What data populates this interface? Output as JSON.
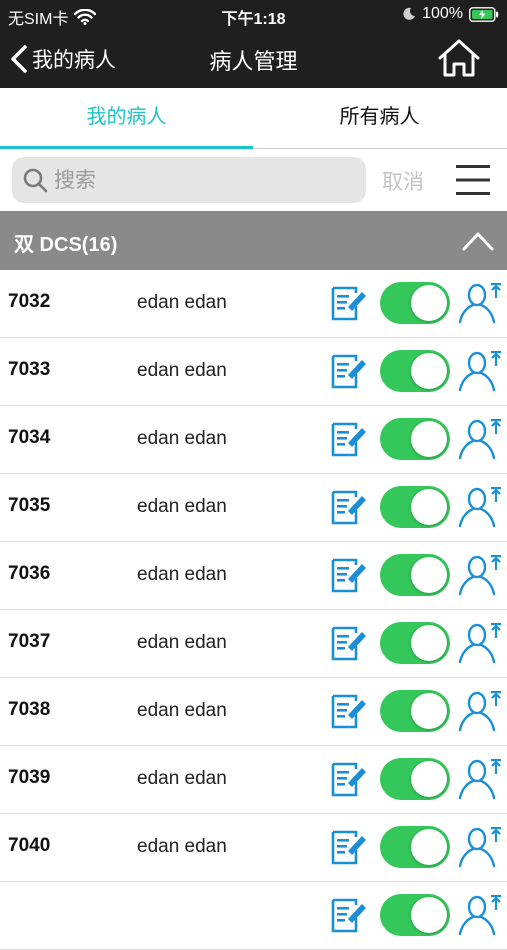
{
  "colors": {
    "accent": "#1cc4c9",
    "toggle_on": "#34c759",
    "icon_blue": "#1a8fd6",
    "header_dark": "#1f1f1f",
    "group_gray": "#8a8a8a"
  },
  "status_bar": {
    "carrier": "无SIM卡",
    "time": "下午1:18",
    "battery": "100%"
  },
  "nav": {
    "back_label": "我的病人",
    "title": "病人管理"
  },
  "tabs": [
    {
      "label": "我的病人",
      "active": true
    },
    {
      "label": "所有病人",
      "active": false
    }
  ],
  "search": {
    "placeholder": "搜索",
    "value": "",
    "cancel_label": "取消"
  },
  "group": {
    "title": "双 DCS(16)"
  },
  "patients": [
    {
      "id": "7032",
      "name": "edan edan",
      "enabled": true
    },
    {
      "id": "7033",
      "name": "edan edan",
      "enabled": true
    },
    {
      "id": "7034",
      "name": "edan edan",
      "enabled": true
    },
    {
      "id": "7035",
      "name": "edan edan",
      "enabled": true
    },
    {
      "id": "7036",
      "name": "edan edan",
      "enabled": true
    },
    {
      "id": "7037",
      "name": "edan edan",
      "enabled": true
    },
    {
      "id": "7038",
      "name": "edan edan",
      "enabled": true
    },
    {
      "id": "7039",
      "name": "edan edan",
      "enabled": true
    },
    {
      "id": "7040",
      "name": "edan edan",
      "enabled": true
    },
    {
      "id": "",
      "name": "",
      "enabled": true
    }
  ]
}
